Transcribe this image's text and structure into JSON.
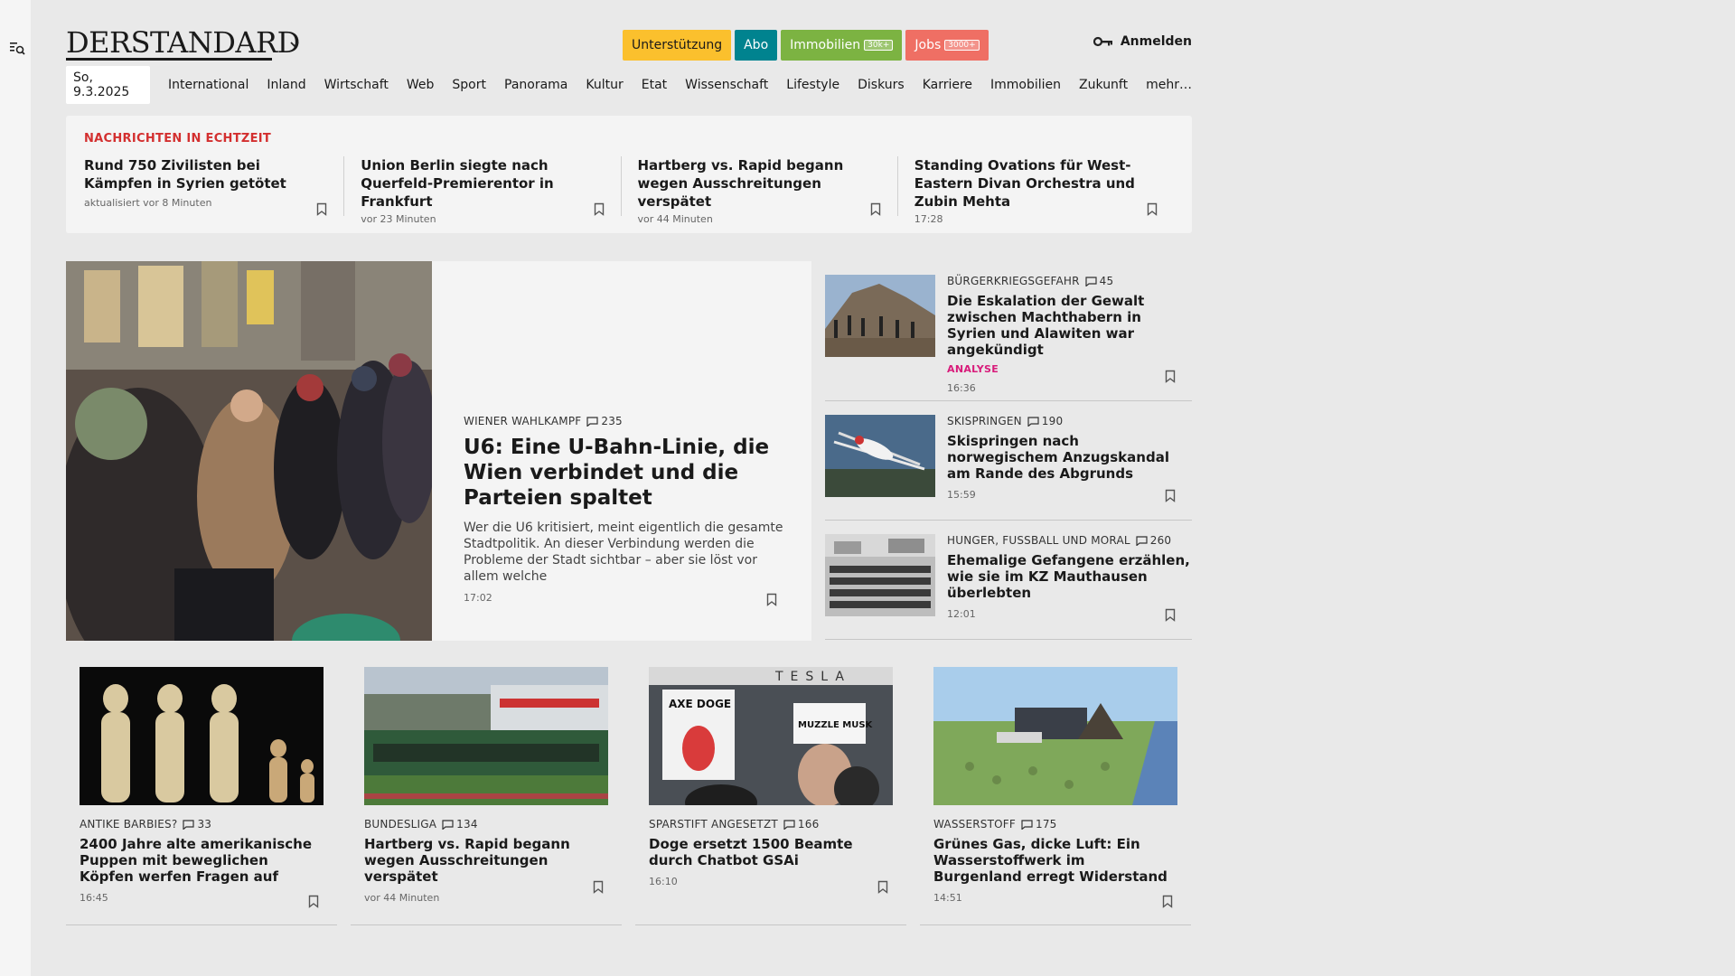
{
  "brand": {
    "logo_text": "DERSTANDARD"
  },
  "promo": [
    {
      "label": "Unterstützung",
      "tag": ""
    },
    {
      "label": "Abo",
      "tag": ""
    },
    {
      "label": "Immobilien",
      "tag": "30k+"
    },
    {
      "label": "Jobs",
      "tag": "3000+"
    }
  ],
  "login_label": "Anmelden",
  "nav": {
    "date": "So, 9.3.2025",
    "items": [
      "International",
      "Inland",
      "Wirtschaft",
      "Web",
      "Sport",
      "Panorama",
      "Kultur",
      "Etat",
      "Wissenschaft",
      "Lifestyle",
      "Diskurs",
      "Karriere",
      "Immobilien",
      "Zukunft",
      "mehr…"
    ]
  },
  "ticker": {
    "heading": "NACHRICHTEN IN ECHTZEIT",
    "items": [
      {
        "title": "Rund 750 Zivilisten bei Kämpfen in Syrien getötet",
        "meta": "aktualisiert vor 8 Minuten",
        "time": ""
      },
      {
        "title": "Union Berlin siegte nach Querfeld-Premierentor in Frankfurt",
        "meta": "",
        "time": "vor 23 Minuten"
      },
      {
        "title": "Hartberg vs. Rapid begann wegen Ausschreitungen verspätet",
        "meta": "",
        "time": "vor 44 Minuten"
      },
      {
        "title": "Standing Ovations für West-Eastern Divan Orchestra und Zubin Mehta",
        "meta": "",
        "time": "17:28"
      }
    ]
  },
  "hero": {
    "kicker": "WIENER WAHLKAMPF",
    "comments": "235",
    "title": "U6: Eine U-Bahn-Linie, die Wien verbindet und die Parteien spaltet",
    "teaser": "Wer die U6 kritisiert, meint eigentlich die gesamte Stadtpolitik. An dieser Verbindung werden die Probleme der Stadt sichtbar – aber sie löst vor allem welche",
    "time": "17:02"
  },
  "side": [
    {
      "kicker": "BÜRGERKRIEGSGEFAHR",
      "comments": "45",
      "title": "Die Eskalation der Gewalt zwischen Machthabern in Syrien und Alawiten war angekündigt",
      "badge": "ANALYSE",
      "time": "16:36"
    },
    {
      "kicker": "SKISPRINGEN",
      "comments": "190",
      "title": "Skispringen nach norwegischem Anzugskandal am Rande des Abgrunds",
      "badge": "",
      "time": "15:59"
    },
    {
      "kicker": "HUNGER, FUSSBALL UND MORAL",
      "comments": "260",
      "title": "Ehemalige Gefangene erzählen, wie sie im KZ Mauthausen überlebten",
      "badge": "",
      "time": "12:01"
    }
  ],
  "cards": [
    {
      "kicker": "ANTIKE BARBIES?",
      "comments": "33",
      "title": "2400 Jahre alte amerikanische Puppen mit beweglichen Köpfen werfen Fragen auf",
      "time": "16:45"
    },
    {
      "kicker": "BUNDESLIGA",
      "comments": "134",
      "title": "Hartberg vs. Rapid begann wegen Ausschreitungen verspätet",
      "time": "vor 44 Minuten"
    },
    {
      "kicker": "SPARSTIFT ANGESETZT",
      "comments": "166",
      "title": "Doge ersetzt 1500 Beamte durch Chatbot GSAi",
      "time": "16:10"
    },
    {
      "kicker": "WASSERSTOFF",
      "comments": "175",
      "title": "Grünes Gas, dicke Luft: Ein Wasserstoffwerk im Burgenland erregt Widerstand",
      "time": "14:51"
    }
  ],
  "image_text": {
    "sign_left": "AXE DOGE",
    "sign_right": "MUZZLE MUSK",
    "banner": "TESLA"
  }
}
